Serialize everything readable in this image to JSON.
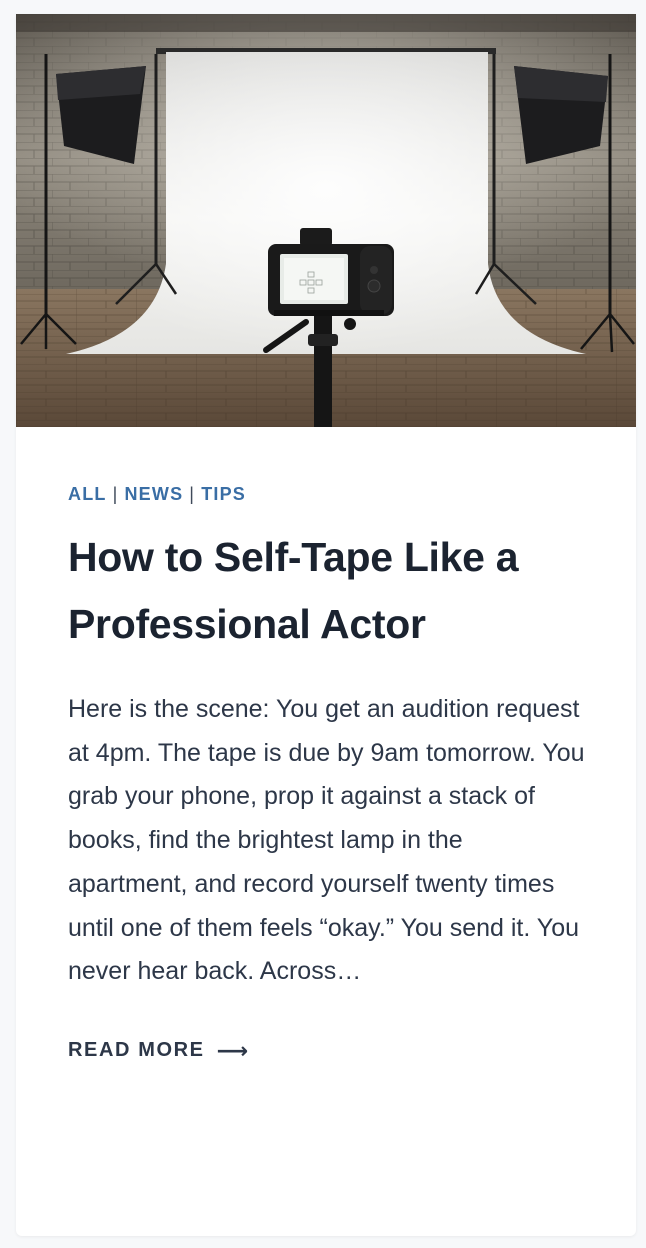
{
  "post": {
    "categories": [
      {
        "label": "ALL"
      },
      {
        "label": "NEWS"
      },
      {
        "label": "TIPS"
      }
    ],
    "separator": "|",
    "title": "How to Self-Tape Like a Professional Actor",
    "excerpt": "Here is the scene: You get an audition request at 4pm. The tape is due by 9am tomorrow. You grab your phone, prop it against a stack of books, find the brightest lamp in the apartment, and record yourself twenty times until one of them feels “okay.” You send it. You never hear back. Across…",
    "read_more_label": "READ MORE",
    "read_more_arrow": "⟶",
    "image_description_icon": "photo-studio-camera-image"
  },
  "colors": {
    "category_link": "#3a6ea5",
    "title": "#1b2330",
    "body_text": "#2d3748",
    "card_bg": "#ffffff",
    "page_bg": "#f7f8fa"
  }
}
